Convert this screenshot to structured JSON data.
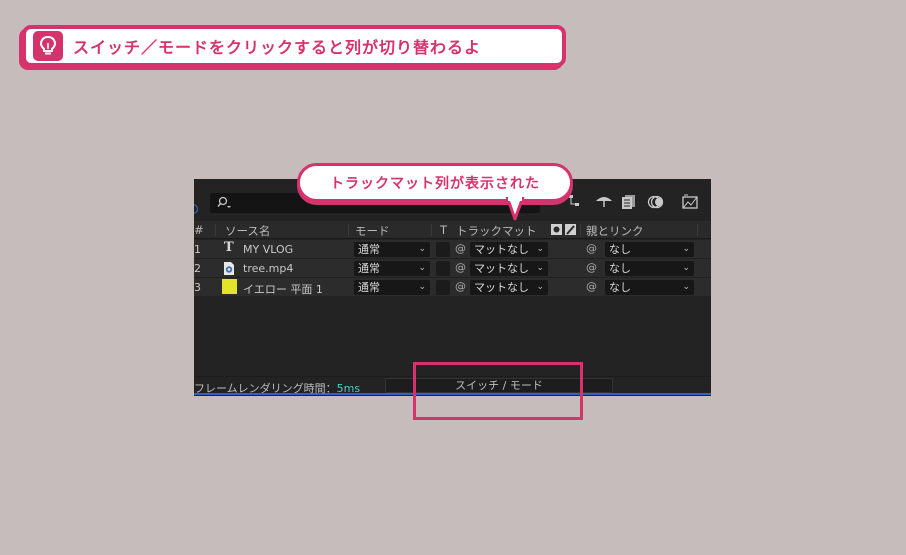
{
  "tip": {
    "icon": "lightbulb-icon",
    "text": "スイッチ／モードをクリックすると列が切り替わるよ"
  },
  "callout": {
    "text": "トラックマット列が表示された"
  },
  "panel": {
    "search": {
      "icon": "search-icon",
      "value": ""
    },
    "tools": [
      "flowchart-icon",
      "draft-3d-icon",
      "frame-blending-icon",
      "motion-blur-icon",
      "graph-editor-icon"
    ],
    "columns": {
      "number": "#",
      "source": "ソース名",
      "mode": "モード",
      "t": "T",
      "trackmatte": "トラックマット",
      "parent": "親とリンク"
    },
    "layers": [
      {
        "num": "1",
        "type": "text-layer-icon",
        "name": "MY VLOG",
        "mode": "通常",
        "matte": "マットなし",
        "parent": "なし"
      },
      {
        "num": "2",
        "type": "video-file-icon",
        "name": "tree.mp4",
        "mode": "通常",
        "matte": "マットなし",
        "parent": "なし"
      },
      {
        "num": "3",
        "type": "solid-layer-icon",
        "name": "イエロー 平面 1",
        "mode": "通常",
        "matte": "マットなし",
        "parent": "なし",
        "solid_color": "#e3e32a"
      }
    ],
    "footer": {
      "render_label": "フレームレンダリング時間：",
      "render_value": "5ms",
      "switch_button": "スイッチ / モード"
    }
  },
  "colors": {
    "accent": "#d6336c",
    "background": "#c6bcbb",
    "panel": "#232323",
    "render_time": "#3fd3c3"
  }
}
